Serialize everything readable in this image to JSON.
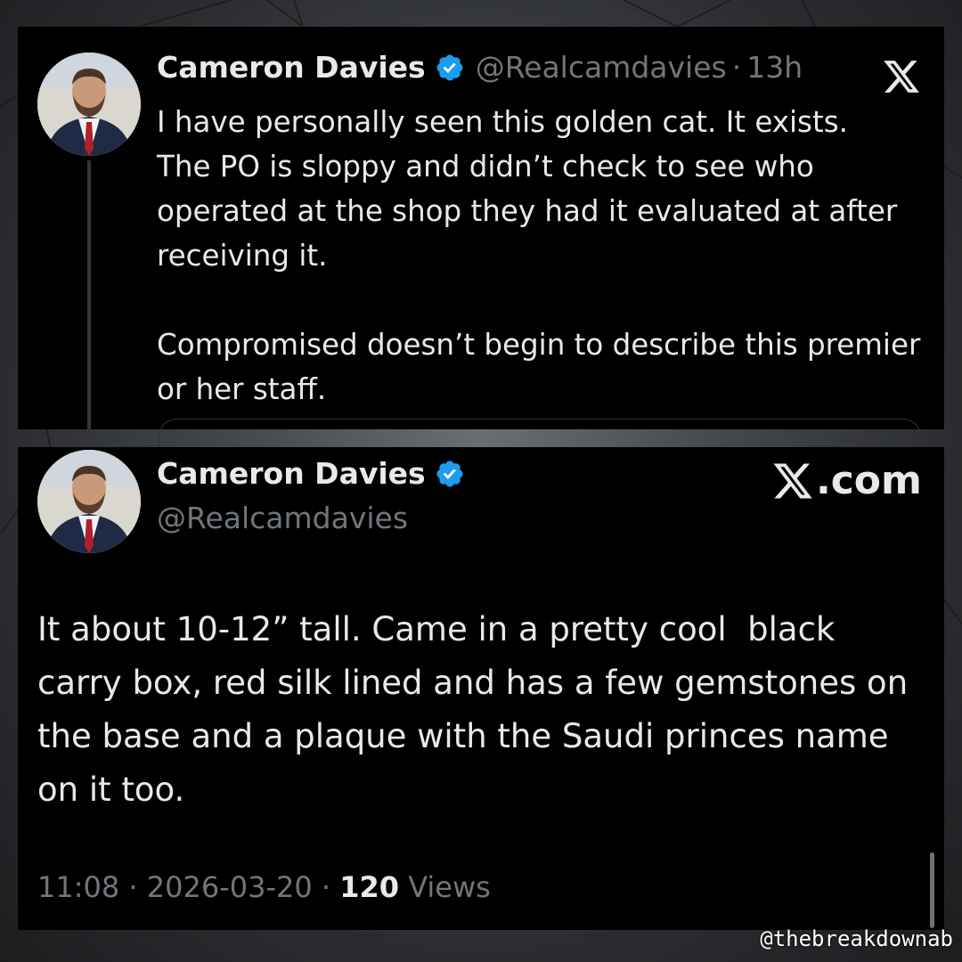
{
  "top_tweet": {
    "display_name": "Cameron Davies",
    "handle": "@Realcamdavies",
    "separator": "·",
    "time_ago": "13h",
    "text": "I have personally seen this golden cat. It exists.\nThe PO is sloppy and didn’t check to see who operated at the shop they had it evaluated at after receiving it.\n\nCompromised doesn’t begin to describe this premier or her staff.",
    "icons": {
      "verified": "verified-badge-icon",
      "logo": "x-logo-icon"
    }
  },
  "bottom_tweet": {
    "display_name": "Cameron Davies",
    "handle": "@Realcamdavies",
    "brand_text": ".com",
    "text": "It about 10-12” tall. Came in a pretty cool  black carry box, red silk lined and has a few gemstones on the base and a plaque with the Saudi princes name on it too.",
    "time": "11:08",
    "separator": "·",
    "date": "2026-03-20",
    "views_count": "120",
    "views_label": "Views"
  },
  "watermark": "@thebreakdownab",
  "colors": {
    "card_bg": "#000000",
    "text": "#e7e9ea",
    "muted": "#71767b",
    "verified": "#1d9bf0",
    "tie": "#b0202a"
  }
}
